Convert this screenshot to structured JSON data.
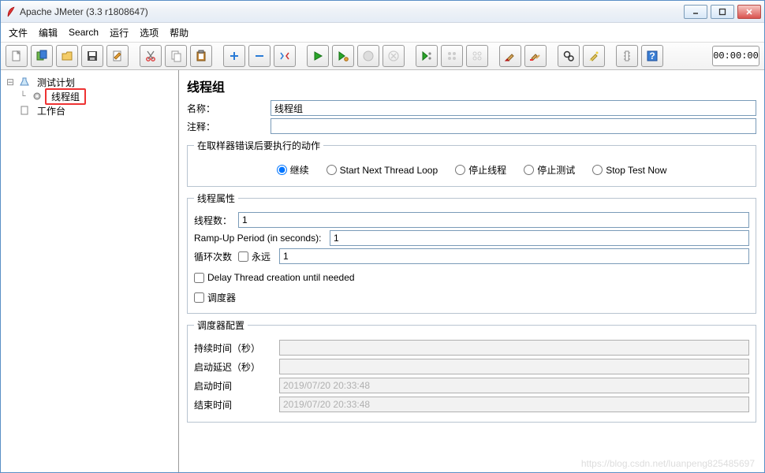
{
  "titlebar": {
    "title": "Apache JMeter (3.3 r1808647)"
  },
  "menu": {
    "file": "文件",
    "edit": "编辑",
    "search": "Search",
    "run": "运行",
    "options": "选项",
    "help": "帮助"
  },
  "timer": "00:00:00",
  "tree": {
    "plan": "测试计划",
    "threadgroup": "线程组",
    "workbench": "工作台"
  },
  "panel": {
    "heading": "线程组",
    "name_label": "名称：",
    "name_value": "线程组",
    "comment_label": "注释：",
    "comment_value": "",
    "error_legend": "在取样器错误后要执行的动作",
    "radios": {
      "r1": "继续",
      "r2": "Start Next Thread Loop",
      "r3": "停止线程",
      "r4": "停止测试",
      "r5": "Stop Test Now"
    },
    "props_legend": "线程属性",
    "threads_label": "线程数：",
    "threads_value": "1",
    "ramp_label": "Ramp-Up Period (in seconds):",
    "ramp_value": "1",
    "loop_label": "循环次数",
    "forever_label": "永远",
    "loop_value": "1",
    "delay_label": "Delay Thread creation until needed",
    "scheduler_label": "调度器",
    "sched_legend": "调度器配置",
    "duration_label": "持续时间（秒）",
    "duration_value": "",
    "startup_delay_label": "启动延迟（秒）",
    "startup_delay_value": "",
    "start_label": "启动时间",
    "start_value": "2019/07/20 20:33:48",
    "end_label": "结束时间",
    "end_value": "2019/07/20 20:33:48"
  },
  "watermark": "https://blog.csdn.net/luanpeng825485697"
}
